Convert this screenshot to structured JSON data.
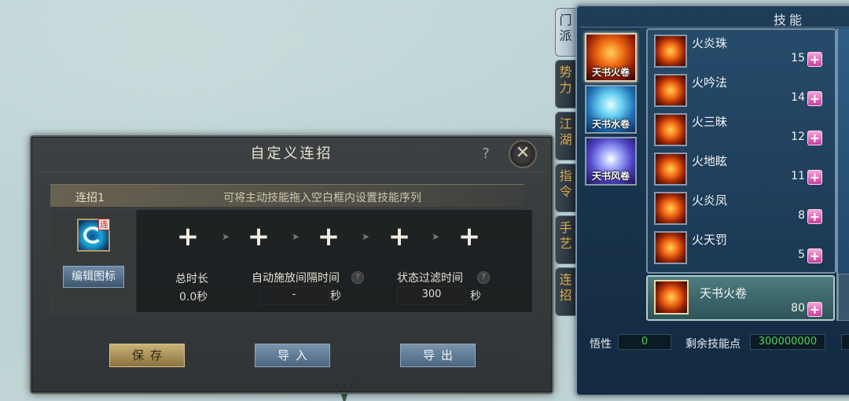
{
  "combo_dialog": {
    "title": "自定义连招",
    "help": "?",
    "close": "✕",
    "combo_name": "连招1",
    "hint": "可将主动技能拖入空白框内设置技能序列",
    "icon_badge": "连",
    "edit_icon_label": "编辑图标",
    "slots": [
      "+",
      "+",
      "+",
      "+",
      "+"
    ],
    "total_duration_label": "总时长",
    "total_duration_value": "0.0秒",
    "auto_interval_label": "自动施放间隔时间",
    "auto_interval_value": "-",
    "auto_interval_unit": "秒",
    "filter_time_label": "状态过滤时间",
    "filter_time_value": "300",
    "filter_time_unit": "秒",
    "save_label": "保存",
    "import_label": "导入",
    "export_label": "导出"
  },
  "skills_panel": {
    "title": "技能",
    "side_tabs": [
      "门派",
      "势力",
      "江湖",
      "指令",
      "手艺",
      "连招"
    ],
    "active_side_tab": "门派",
    "books": [
      {
        "label": "天书火卷",
        "active": true
      },
      {
        "label": "天书水卷",
        "active": false
      },
      {
        "label": "天书风卷",
        "active": false
      }
    ],
    "skills": [
      {
        "name": "火炎珠",
        "level": "15",
        "plus": "+"
      },
      {
        "name": "火吟法",
        "level": "14",
        "plus": "+"
      },
      {
        "name": "火三昧",
        "level": "12",
        "plus": "+"
      },
      {
        "name": "火地眩",
        "level": "11",
        "plus": "+"
      },
      {
        "name": "火炎凤",
        "level": "8",
        "plus": "+"
      },
      {
        "name": "火天罚",
        "level": "5",
        "plus": "+"
      }
    ],
    "selected_skill": {
      "name": "天书火卷",
      "level": "80",
      "plus": "+"
    },
    "wuxing_label": "悟性",
    "wuxing_value": "0",
    "remaining_points_label": "剩余技能点",
    "remaining_points_value": "300000000",
    "colors": {
      "panel": "#1e3d58",
      "level_plus": "#d64fa9",
      "stat_green": "#50d35a",
      "tab_gold": "#d9a94a"
    }
  }
}
